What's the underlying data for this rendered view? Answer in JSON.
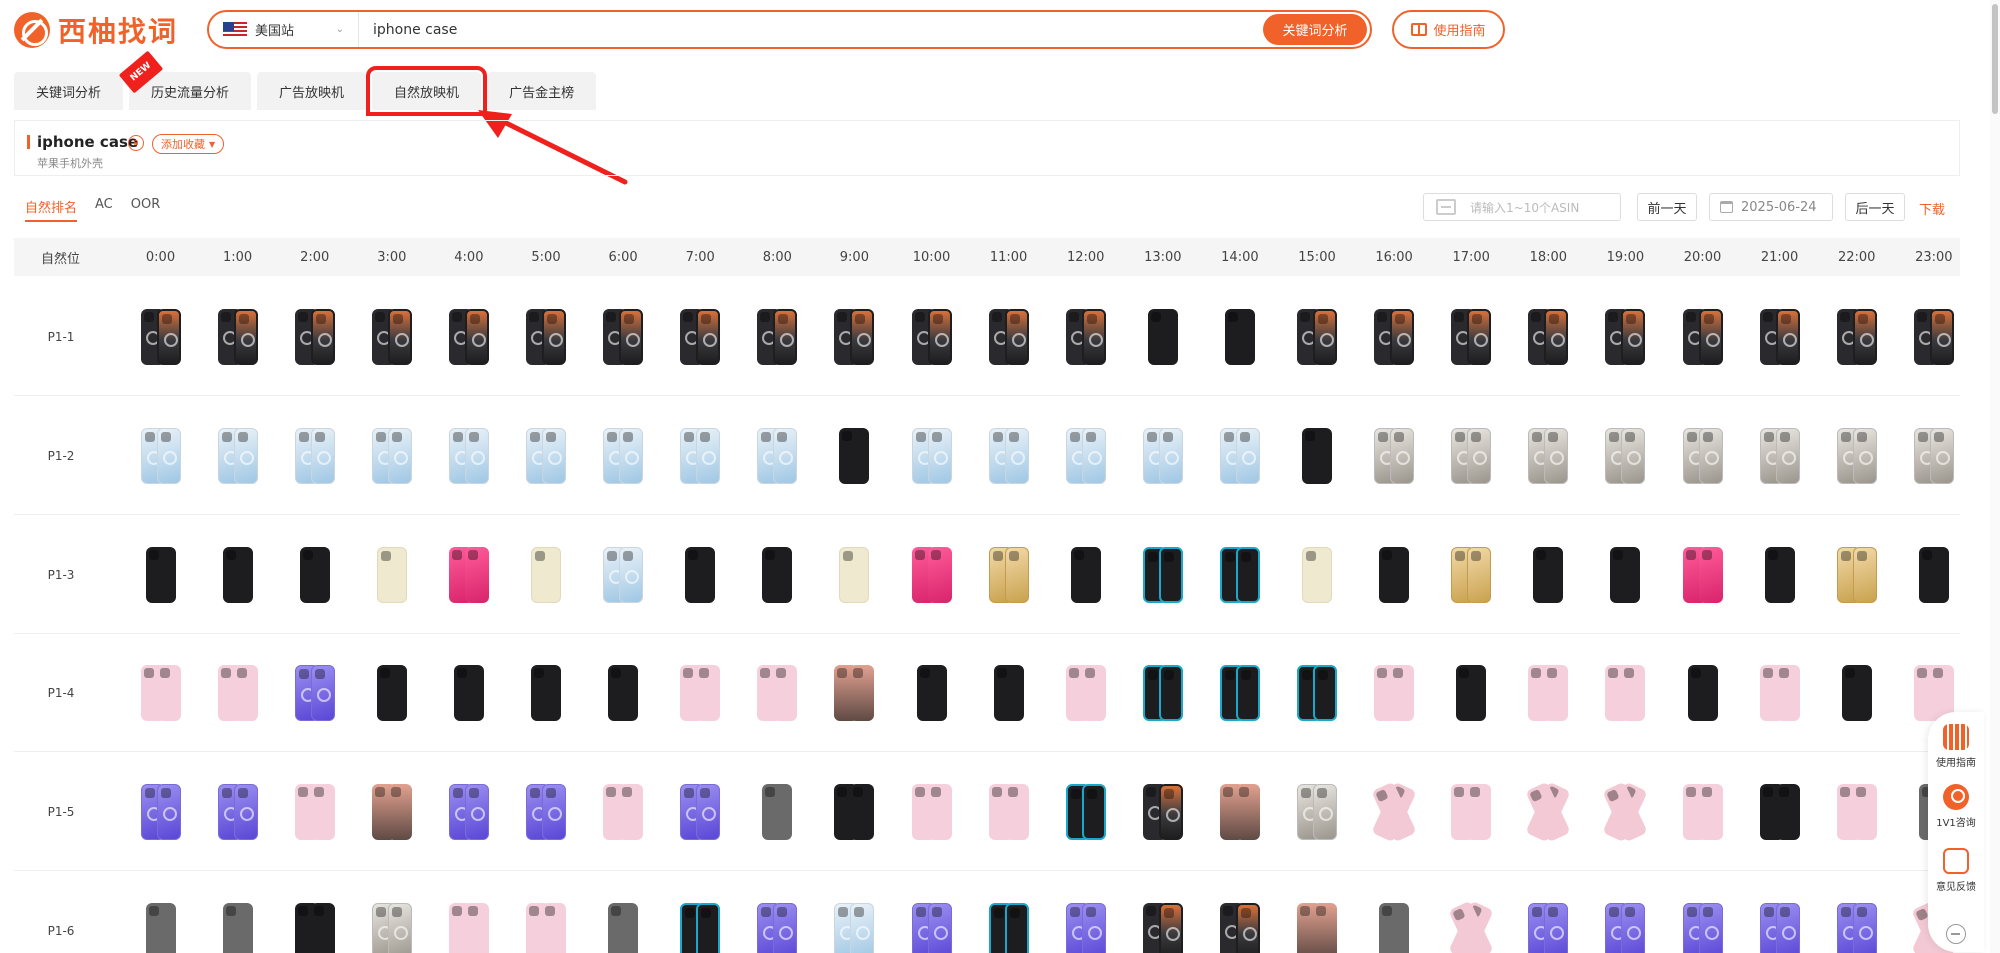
{
  "header": {
    "logo_text": "西柚找词",
    "site_label": "美国站",
    "search_value": "iphone case",
    "search_button": "关键词分析",
    "guide_button": "使用指南"
  },
  "tabs": [
    {
      "label": "关键词分析",
      "active": false
    },
    {
      "label": "历史流量分析",
      "active": false
    },
    {
      "label": "广告放映机",
      "active": false
    },
    {
      "label": "自然放映机",
      "active": true
    },
    {
      "label": "广告金主榜",
      "active": false
    }
  ],
  "new_badge": "NEW",
  "keyword": {
    "title": "iphone case",
    "subtitle": "苹果手机外壳",
    "badge": "a",
    "favorite_label": "添加收藏"
  },
  "subtabs": [
    {
      "label": "自然排名",
      "active": true
    },
    {
      "label": "AC",
      "active": false
    },
    {
      "label": "OOR",
      "active": false
    }
  ],
  "toolbar": {
    "asin_placeholder": "请输入1~10个ASIN",
    "prev_day": "前一天",
    "date": "2025-06-24",
    "next_day": "后一天",
    "download": "下载"
  },
  "grid": {
    "position_header": "自然位",
    "hours": [
      "0:00",
      "1:00",
      "2:00",
      "3:00",
      "4:00",
      "5:00",
      "6:00",
      "7:00",
      "8:00",
      "9:00",
      "10:00",
      "11:00",
      "12:00",
      "13:00",
      "14:00",
      "15:00",
      "16:00",
      "17:00",
      "18:00",
      "19:00",
      "20:00",
      "21:00",
      "22:00",
      "23:00"
    ],
    "rows": [
      {
        "label": "P1-1",
        "cells": [
          "k",
          "k",
          "k",
          "k",
          "k",
          "k",
          "k",
          "k",
          "k",
          "k",
          "k",
          "k",
          "k",
          "b1",
          "b1",
          "k",
          "k",
          "k",
          "k",
          "k",
          "k",
          "k",
          "k",
          "k"
        ]
      },
      {
        "label": "P1-2",
        "cells": [
          "c",
          "c",
          "c",
          "c",
          "c",
          "c",
          "c",
          "c",
          "c",
          "b1",
          "c",
          "c",
          "c",
          "c",
          "c",
          "b1",
          "t",
          "t",
          "t",
          "t",
          "t",
          "t",
          "t",
          "t"
        ]
      },
      {
        "label": "P1-3",
        "cells": [
          "b1",
          "b1",
          "b1",
          "y1",
          "h",
          "y1",
          "c",
          "b1",
          "b1",
          "y1",
          "h",
          "g",
          "b1",
          "tl",
          "tl",
          "y1",
          "b1",
          "g",
          "b1",
          "b1",
          "h",
          "b1",
          "g",
          "b1"
        ]
      },
      {
        "label": "P1-4",
        "cells": [
          "p",
          "p",
          "v",
          "b1",
          "b1",
          "b1",
          "b1",
          "p",
          "p",
          "r",
          "b1",
          "b1",
          "p",
          "tl",
          "tl",
          "tl",
          "p",
          "b1",
          "p",
          "p",
          "b1",
          "p",
          "b1",
          "p"
        ]
      },
      {
        "label": "P1-5",
        "cells": [
          "v",
          "v",
          "p",
          "r",
          "v",
          "v",
          "p",
          "v",
          "gr1",
          "b",
          "p",
          "p",
          "tl",
          "k",
          "r",
          "t",
          "x",
          "p",
          "x",
          "x",
          "p",
          "b",
          "p",
          "gr1"
        ]
      },
      {
        "label": "P1-6",
        "cells": [
          "gr1",
          "gr1",
          "b",
          "t",
          "p",
          "p",
          "gr1",
          "tl",
          "v",
          "c",
          "v",
          "tl",
          "v",
          "k",
          "k",
          "r",
          "gr1",
          "x",
          "v",
          "v",
          "v",
          "v",
          "v",
          "x"
        ]
      }
    ]
  },
  "float_panel": {
    "guide": "使用指南",
    "consult": "1V1咨询",
    "feedback": "意见反馈"
  },
  "colors": {
    "accent": "#f0622a",
    "highlight": "#f0211d"
  }
}
